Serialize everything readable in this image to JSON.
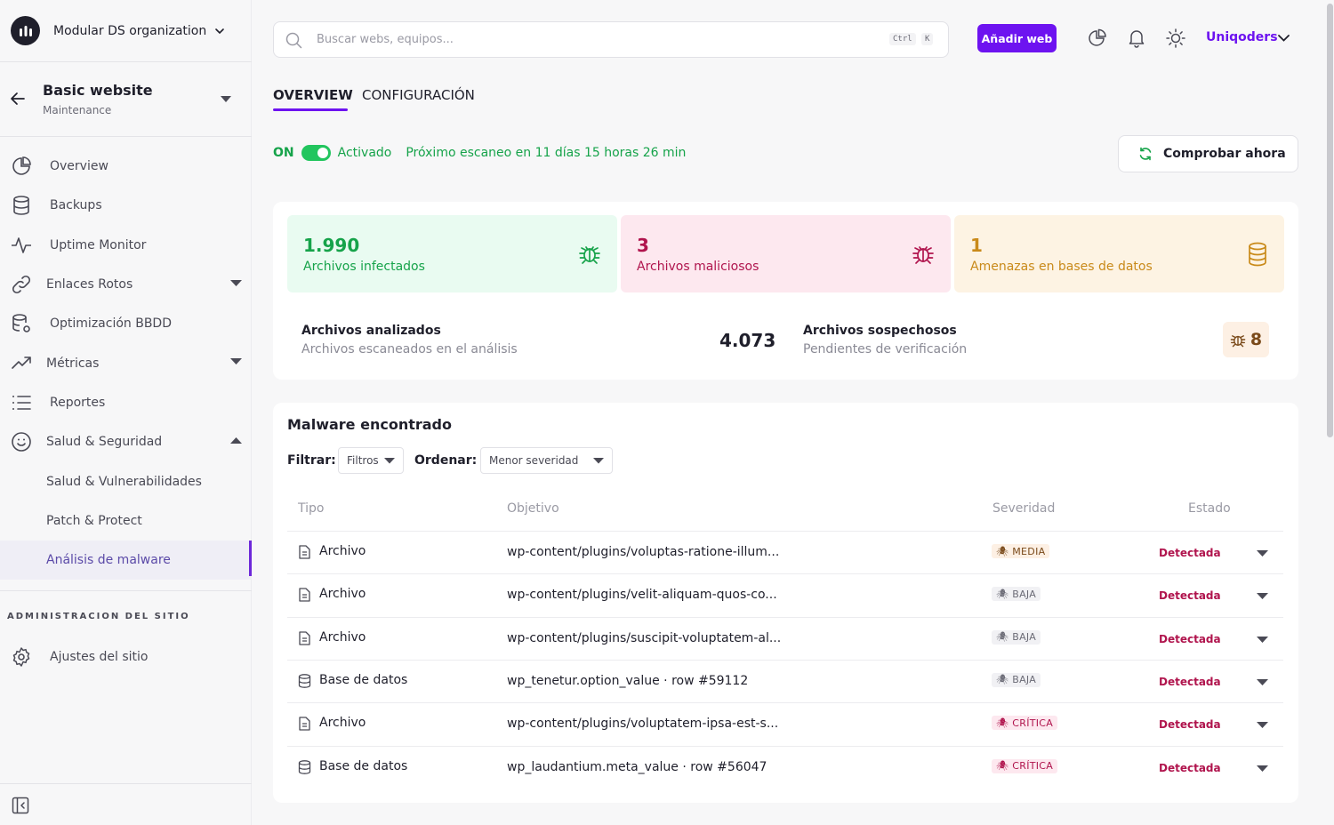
{
  "org": {
    "name": "Modular DS organization"
  },
  "site": {
    "title": "Basic website",
    "subtitle": "Maintenance"
  },
  "nav": {
    "items": [
      {
        "label": "Overview"
      },
      {
        "label": "Backups"
      },
      {
        "label": "Uptime Monitor"
      },
      {
        "label": "Enlaces Rotos"
      },
      {
        "label": "Optimización BBDD"
      },
      {
        "label": "Métricas"
      },
      {
        "label": "Reportes"
      },
      {
        "label": "Salud & Seguridad"
      },
      {
        "label": "Salud & Vulnerabilidades"
      },
      {
        "label": "Patch & Protect"
      },
      {
        "label": "Análisis de malware"
      }
    ]
  },
  "admin": {
    "section_title": "ADMINISTRACION DEL SITIO",
    "settings_label": "Ajustes del sitio"
  },
  "topbar": {
    "search_placeholder": "Buscar webs, equipos...",
    "kbd_ctrl": "Ctrl",
    "kbd_k": "K",
    "add_button": "Añadir web",
    "user": "Uniqoders"
  },
  "tabs": {
    "overview": "OVERVIEW",
    "config": "CONFIGURACIÓN"
  },
  "status": {
    "on": "ON",
    "activated": "Activado",
    "next_scan": "Próximo escaneo en 11 días 15 horas 26 min",
    "check_button": "Comprobar ahora"
  },
  "cards": [
    {
      "value": "1.990",
      "label": "Archivos infectados",
      "color": "#16a34a"
    },
    {
      "value": "3",
      "label": "Archivos maliciosos",
      "color": "#b0144d"
    },
    {
      "value": "1",
      "label": "Amenazas en bases de datos",
      "color": "#c98a1a"
    }
  ],
  "stats": {
    "analyzed_title": "Archivos analizados",
    "analyzed_sub": "Archivos escaneados en el análisis",
    "analyzed_value": "4.073",
    "suspicious_title": "Archivos sospechosos",
    "suspicious_sub": "Pendientes de verificación",
    "suspicious_value": "8"
  },
  "malware": {
    "title": "Malware encontrado",
    "filter_label": "Filtrar:",
    "filter_value": "Filtros",
    "order_label": "Ordenar:",
    "order_value": "Menor severidad",
    "columns": {
      "type": "Tipo",
      "target": "Objetivo",
      "severity": "Severidad",
      "status": "Estado"
    },
    "rows": [
      {
        "type": "Archivo",
        "target": "wp-content/plugins/voluptas-ratione-illum...",
        "severity": "MEDIA",
        "status": "Detectada"
      },
      {
        "type": "Archivo",
        "target": "wp-content/plugins/velit-aliquam-quos-co...",
        "severity": "BAJA",
        "status": "Detectada"
      },
      {
        "type": "Archivo",
        "target": "wp-content/plugins/suscipit-voluptatem-al...",
        "severity": "BAJA",
        "status": "Detectada"
      },
      {
        "type": "Base de datos",
        "target": "wp_tenetur.option_value · row #59112",
        "severity": "BAJA",
        "status": "Detectada"
      },
      {
        "type": "Archivo",
        "target": "wp-content/plugins/voluptatem-ipsa-est-s...",
        "severity": "CRÍTICA",
        "status": "Detectada"
      },
      {
        "type": "Base de datos",
        "target": "wp_laudantium.meta_value · row #56047",
        "severity": "CRÍTICA",
        "status": "Detectada"
      }
    ]
  },
  "colors": {
    "accent": "#6d13f0",
    "success": "#16a34a",
    "danger": "#b0144d",
    "warning": "#c98a1a"
  }
}
